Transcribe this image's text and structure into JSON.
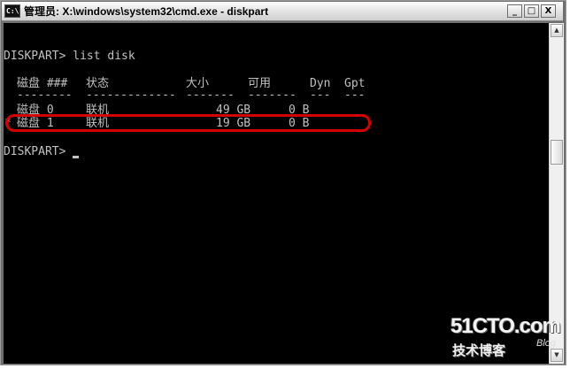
{
  "window": {
    "title": "管理员: X:\\windows\\system32\\cmd.exe - diskpart",
    "icon_text": "C:\\",
    "buttons": {
      "minimize": "_",
      "maximize": "□",
      "close": "X"
    }
  },
  "console": {
    "command_line": "DISKPART> list disk",
    "table": {
      "headers": [
        "磁盘 ###",
        "状态",
        "大小",
        "可用",
        "Dyn",
        "Gpt"
      ],
      "separators": [
        "--------",
        "-------------",
        "-------",
        "-------",
        "---",
        "---"
      ],
      "rows": [
        {
          "marker": "",
          "disk": "磁盘 0",
          "status": "联机",
          "size": "49 GB",
          "free": "0 B",
          "dyn": "",
          "gpt": ""
        },
        {
          "marker": "*",
          "disk": "磁盘 1",
          "status": "联机",
          "size": "19 GB",
          "free": "0 B",
          "dyn": "",
          "gpt": ""
        }
      ]
    },
    "prompt": "DISKPART> "
  },
  "scrollbar": {
    "up": "▲",
    "down": "▼"
  },
  "watermark": {
    "logo": "51CTO.com",
    "subtitle": "技术博客",
    "blog": "Blog"
  },
  "colors": {
    "console_bg": "#000000",
    "console_text": "#c0c0c0",
    "highlight": "#d40000"
  }
}
